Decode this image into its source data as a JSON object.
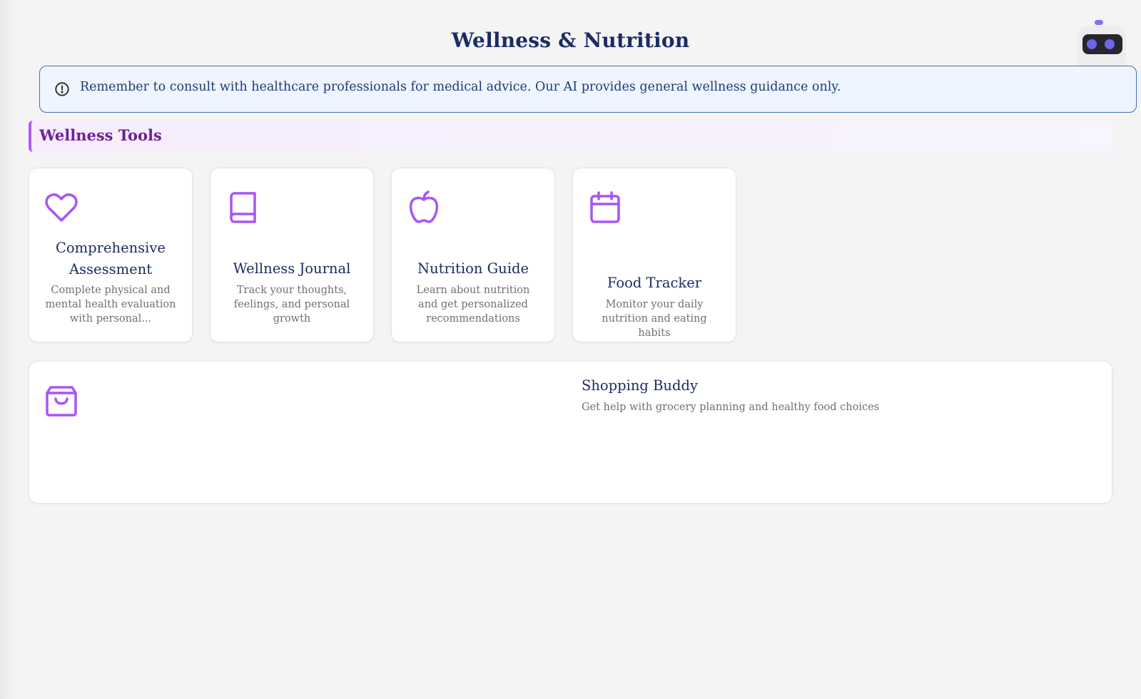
{
  "page": {
    "title": "Wellness & Nutrition"
  },
  "notice": {
    "icon": "alert-circle-icon",
    "text": "Remember to consult with healthcare professionals for medical advice. Our AI provides general wellness guidance only."
  },
  "section": {
    "title": "Wellness Tools"
  },
  "tools": [
    {
      "icon": "heart-icon",
      "title": "Comprehensive Assessment",
      "description": "Complete physical and mental health evaluation with personal..."
    },
    {
      "icon": "book-icon",
      "title": "Wellness Journal",
      "description": "Track your thoughts, feelings, and personal growth"
    },
    {
      "icon": "apple-icon",
      "title": "Nutrition Guide",
      "description": "Learn about nutrition and get personalized recommendations"
    },
    {
      "icon": "calendar-icon",
      "title": "Food Tracker",
      "description": "Monitor your daily nutrition and eating habits"
    }
  ],
  "shopping": {
    "icon": "shopping-bag-icon",
    "title": "Shopping Buddy",
    "description": "Get help with grocery planning and healthy food choices"
  },
  "assistant": {
    "icon": "robot-assistant-icon"
  },
  "colors": {
    "accent_purple": "#a855f7",
    "heading_navy": "#1b2c62",
    "notice_border": "#3b6fb6",
    "notice_bg": "#eef5fe"
  }
}
